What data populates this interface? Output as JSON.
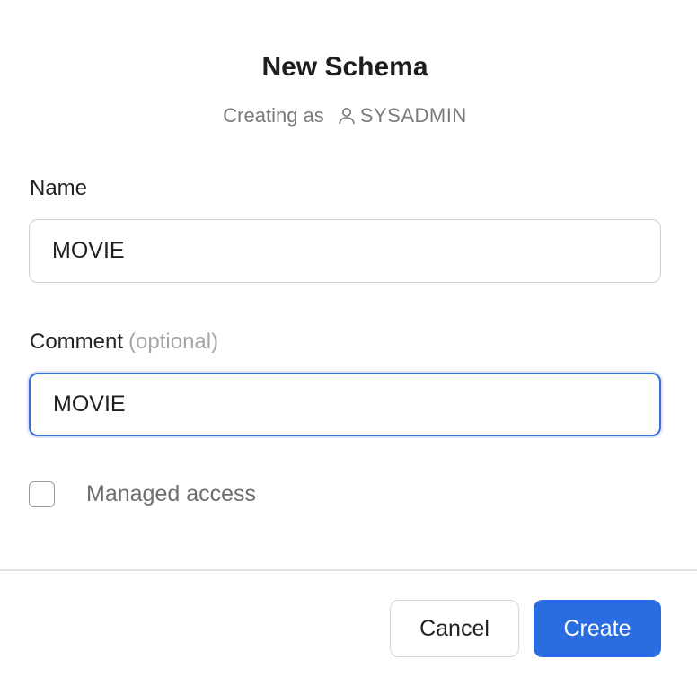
{
  "dialog": {
    "title": "New Schema",
    "subtitle_prefix": "Creating as",
    "role": "SYSADMIN",
    "role_icon": "user-icon"
  },
  "fields": {
    "name": {
      "label": "Name",
      "value": "MOVIE"
    },
    "comment": {
      "label": "Comment",
      "optional_label": "(optional)",
      "value": "MOVIE"
    }
  },
  "managed_access": {
    "label": "Managed access",
    "checked": false
  },
  "footer": {
    "cancel_label": "Cancel",
    "create_label": "Create"
  },
  "colors": {
    "primary": "#2a6de0",
    "focus_border": "#3b6fd4"
  }
}
